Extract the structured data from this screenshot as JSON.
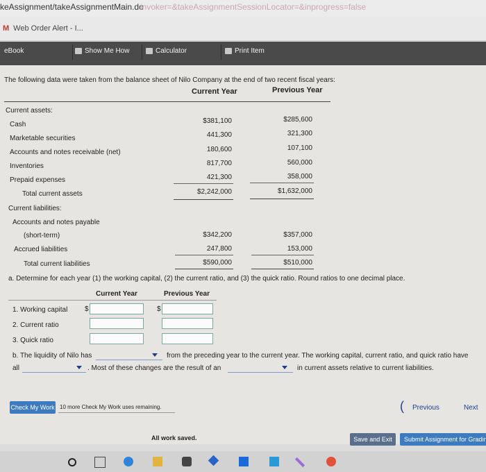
{
  "browser": {
    "url_path": "keAssignment/takeAssignmentMain.do",
    "url_faded": "invoker=&takeAssignmentSessionLocator=&inprogress=false",
    "tab_title": "Web Order Alert - I..."
  },
  "toolbar": {
    "ebook": "eBook",
    "show_me_how": "Show Me How",
    "calculator": "Calculator",
    "print_item": "Print Item"
  },
  "intro": "The following data were taken from the balance sheet of Nilo Company at the end of two recent fiscal years:",
  "headers": {
    "current": "Current Year",
    "previous": "Previous Year"
  },
  "balance": {
    "current_assets_label": "Current assets:",
    "assets": [
      {
        "label": "Cash",
        "current": "$381,100",
        "previous": "$285,600"
      },
      {
        "label": "Marketable securities",
        "current": "441,300",
        "previous": "321,300"
      },
      {
        "label": "Accounts and notes receivable (net)",
        "current": "180,600",
        "previous": "107,100"
      },
      {
        "label": "Inventories",
        "current": "817,700",
        "previous": "560,000"
      },
      {
        "label": "Prepaid expenses",
        "current": "421,300",
        "previous": "358,000"
      }
    ],
    "total_assets": {
      "label": "Total current assets",
      "current": "$2,242,000",
      "previous": "$1,632,000"
    },
    "current_liabilities_label": "Current liabilities:",
    "ap_label_1": "Accounts and notes payable",
    "ap_label_2": "(short-term)",
    "ap": {
      "current": "$342,200",
      "previous": "$357,000"
    },
    "accrued": {
      "label": "Accrued liabilities",
      "current": "247,800",
      "previous": "153,000"
    },
    "total_liabilities": {
      "label": "Total current liabilities",
      "current": "$590,000",
      "previous": "$510,000"
    }
  },
  "question_a": "a.  Determine for each year (1) the working capital, (2) the current ratio, and (3) the quick ratio. Round ratios to one decimal place.",
  "answer_headers": {
    "current": "Current Year",
    "previous": "Previous Year"
  },
  "answer_rows": [
    {
      "label": "1.  Working capital",
      "dollar": "$"
    },
    {
      "label": "2.  Current ratio"
    },
    {
      "label": "3.  Quick ratio"
    }
  ],
  "question_b": {
    "prefix": "b.  The liquidity of Nilo has",
    "middle": "from the preceding year to the current year. The working capital, current ratio, and quick ratio have",
    "line2_start": "all",
    "line2_middle": ". Most of these changes are the result of an",
    "line2_end": "in current assets relative to current liabilities."
  },
  "footer": {
    "check_button": "Check My Work",
    "check_remaining": "10 more Check My Work uses remaining.",
    "previous": "Previous",
    "next": "Next",
    "saved_status": "All work saved.",
    "save_exit": "Save and Exit",
    "submit": "Submit Assignment for Grading"
  }
}
